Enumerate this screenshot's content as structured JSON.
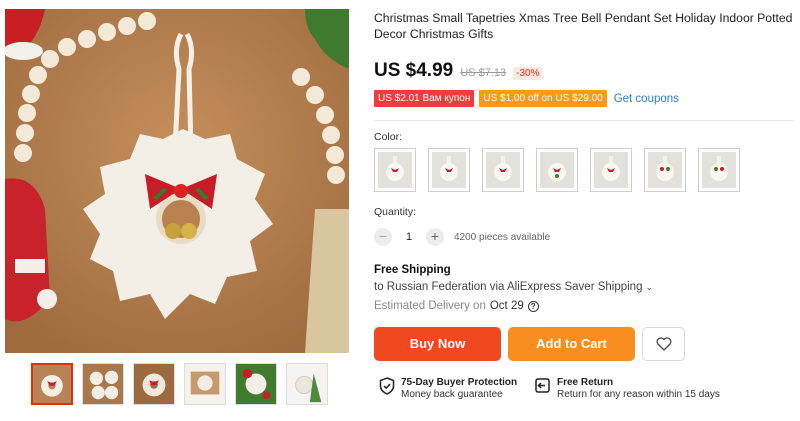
{
  "product": {
    "title": "Christmas Small Tapetries Xmas Tree Bell Pendant Set Holiday Indoor Potted Decor Christmas Gifts",
    "price": "US $4.99",
    "original_price": "US $7.13",
    "discount": "-30%"
  },
  "coupons": [
    {
      "text": "US $2.01 Вам купон",
      "color": "#f23c3c"
    },
    {
      "text": "US $1.00 off on US $29.00",
      "color": "#fc9b13"
    }
  ],
  "get_coupons_label": "Get coupons",
  "color_label": "Color:",
  "quantity_label": "Quantity:",
  "quantity": {
    "minus": "−",
    "value": "1",
    "plus": "+",
    "available": "4200 pieces available"
  },
  "shipping": {
    "title": "Free Shipping",
    "to": "to Russian Federation via AliExpress Saver Shipping",
    "estimated_label": "Estimated Delivery on",
    "estimated_date": "Oct 29"
  },
  "buttons": {
    "buy_now": "Buy Now",
    "add_to_cart": "Add to Cart"
  },
  "guarantees": [
    {
      "title": "75-Day Buyer Protection",
      "subtitle": "Money back guarantee",
      "icon": "shield-check-icon"
    },
    {
      "title": "Free Return",
      "subtitle": "Return for any reason within 15 days",
      "icon": "return-box-icon"
    }
  ],
  "colors": {
    "accent_red": "#f0491f",
    "accent_orange": "#f98e20",
    "link_blue": "#2e7cc8"
  }
}
